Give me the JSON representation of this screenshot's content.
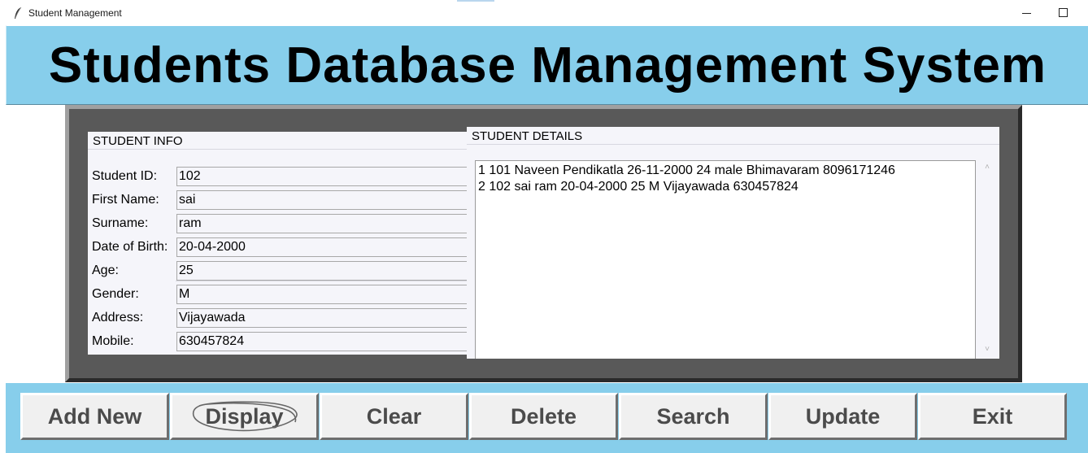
{
  "window": {
    "title": "Student Management",
    "app_icon": "feather-icon",
    "minimize_icon": "minimize-icon",
    "maximize_icon": "maximize-icon"
  },
  "header": {
    "title": "Students Database Management System"
  },
  "student_info": {
    "title": "STUDENT INFO",
    "fields": [
      {
        "label": "Student ID:",
        "value": "102"
      },
      {
        "label": "First Name:",
        "value": "sai"
      },
      {
        "label": "Surname:",
        "value": "ram"
      },
      {
        "label": "Date of Birth:",
        "value": "20-04-2000"
      },
      {
        "label": "Age:",
        "value": "25"
      },
      {
        "label": "Gender:",
        "value": "M"
      },
      {
        "label": "Address:",
        "value": "Vijayawada"
      },
      {
        "label": "Mobile:",
        "value": "630457824"
      }
    ]
  },
  "student_details": {
    "title": "STUDENT DETAILS",
    "records": [
      "1 101 Naveen Pendikatla 26-11-2000 24 male Bhimavaram 8096171246",
      "2 102 sai ram 20-04-2000 25 M Vijayawada 630457824"
    ]
  },
  "buttons": {
    "add_new": "Add New",
    "display": "Display",
    "clear": "Clear",
    "delete": "Delete",
    "search": "Search",
    "update": "Update",
    "exit": "Exit"
  },
  "colors": {
    "header_bg": "#87ceeb",
    "frame_bg": "#595959",
    "panel_bg": "#f5f5fa",
    "button_bg": "#f0f0f0",
    "button_text": "#4b4b4b"
  }
}
